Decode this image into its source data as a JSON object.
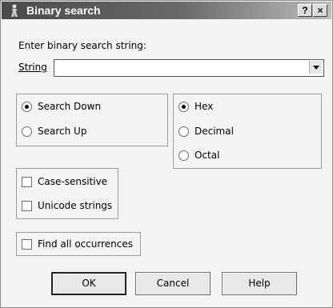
{
  "window": {
    "title": "Binary search",
    "help_button": "?",
    "close_button": "×"
  },
  "prompt": "Enter binary search string:",
  "string_field": {
    "label": "String",
    "value": ""
  },
  "direction": {
    "options": [
      "Search Down",
      "Search Up"
    ],
    "selected": "Search Down"
  },
  "base": {
    "options": [
      "Hex",
      "Decimal",
      "Octal"
    ],
    "selected": "Hex"
  },
  "options_group": {
    "case_sensitive": {
      "label": "Case-sensitive",
      "checked": false
    },
    "unicode_strings": {
      "label": "Unicode strings",
      "checked": false
    }
  },
  "find_all": {
    "label": "Find all occurrences",
    "checked": false
  },
  "buttons": {
    "ok": "OK",
    "cancel": "Cancel",
    "help": "Help"
  }
}
